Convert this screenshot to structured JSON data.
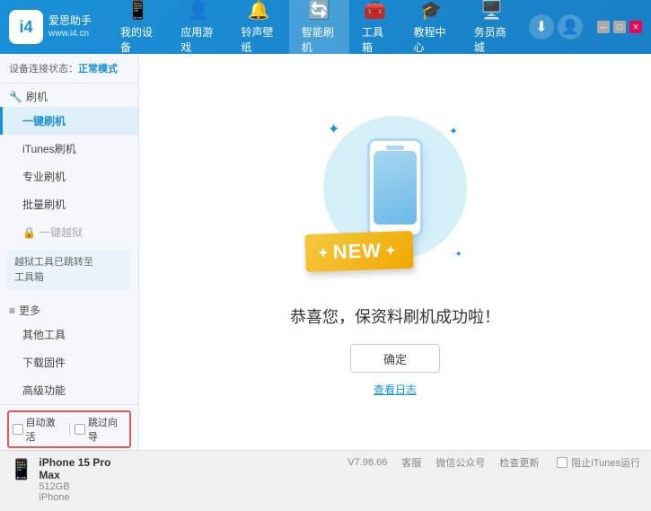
{
  "header": {
    "logo_abbr": "i4",
    "logo_name": "爱思助手",
    "logo_sub": "www.i4.cn",
    "nav_items": [
      {
        "id": "my-device",
        "icon": "📱",
        "label": "我的设备"
      },
      {
        "id": "apps-games",
        "icon": "👤",
        "label": "应用游戏"
      },
      {
        "id": "ringtones",
        "icon": "🔔",
        "label": "铃声壁纸"
      },
      {
        "id": "smart-flash",
        "icon": "🔄",
        "label": "智能刷机"
      },
      {
        "id": "toolbox",
        "icon": "🧰",
        "label": "工具箱"
      },
      {
        "id": "tutorial",
        "icon": "🎓",
        "label": "教程中心"
      },
      {
        "id": "service",
        "icon": "🖥️",
        "label": "务员商城"
      }
    ],
    "download_btn": "⬇",
    "user_btn": "👤",
    "win_min": "—",
    "win_max": "□",
    "win_close": "✕"
  },
  "sidebar": {
    "status_prefix": "设备连接状态：",
    "status_text": "正常模式",
    "flash_label": "刷机",
    "flash_icon": "🔧",
    "menu_items": [
      {
        "id": "one-key-flash",
        "label": "一键刷机",
        "active": true
      },
      {
        "id": "itunes-flash",
        "label": "iTunes刷机",
        "active": false
      },
      {
        "id": "pro-flash",
        "label": "专业刷机",
        "active": false
      },
      {
        "id": "batch-flash",
        "label": "批量刷机",
        "active": false
      }
    ],
    "one_key_restore_label": "一键越狱",
    "one_key_restore_disabled": true,
    "disabled_box_text": "越狱工具已跳转至\n工具箱",
    "more_label": "更多",
    "more_icon": "≡",
    "more_items": [
      {
        "id": "other-tools",
        "label": "其他工具"
      },
      {
        "id": "download-firmware",
        "label": "下载固件"
      },
      {
        "id": "advanced",
        "label": "高级功能"
      }
    ],
    "auto_activate_label": "自动激活",
    "skip_guide_label": "跳过向导",
    "device_name": "iPhone 15 Pro Max",
    "device_storage": "512GB",
    "device_type": "iPhone",
    "stop_itunes_label": "阻止iTunes运行"
  },
  "content": {
    "new_label": "NEW",
    "success_message": "恭喜您，保资料刷机成功啦！",
    "confirm_button": "确定",
    "view_log_label": "查看日志"
  },
  "footer": {
    "version": "V7.98.66",
    "links": [
      "客服",
      "微信公众号",
      "检查更新"
    ]
  }
}
